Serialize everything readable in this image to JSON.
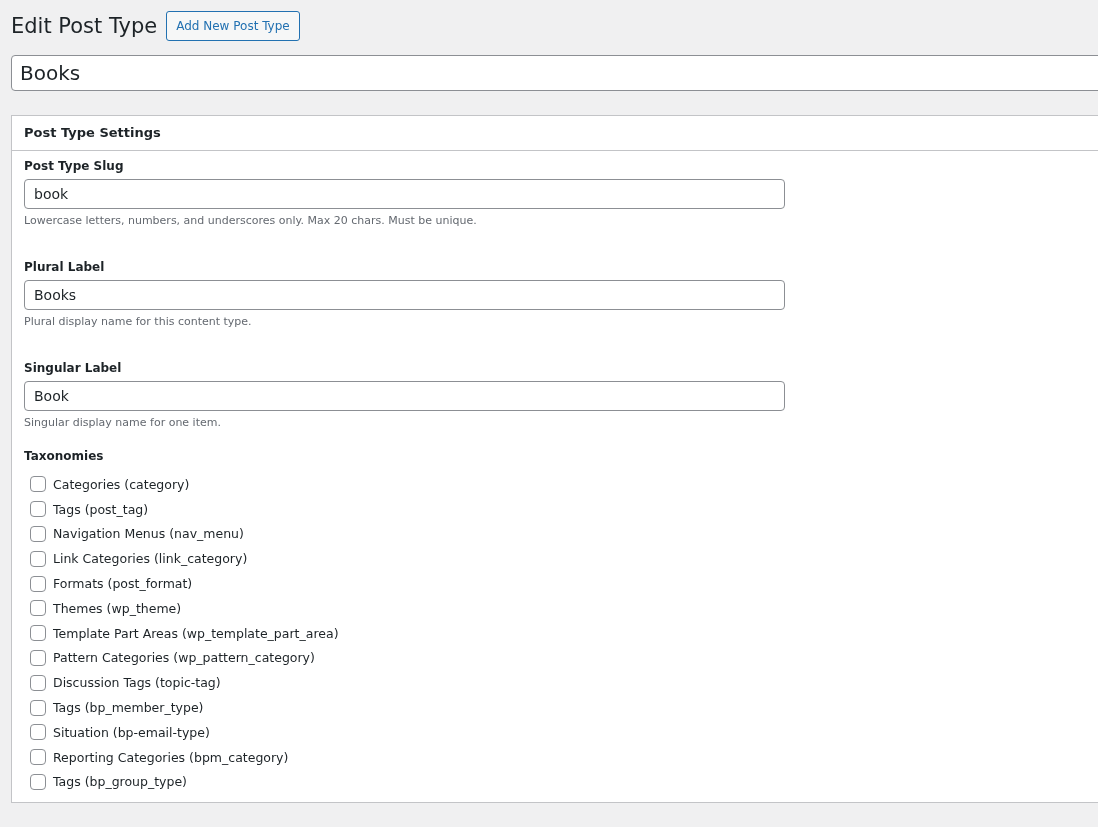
{
  "heading": "Edit Post Type",
  "add_button": "Add New Post Type",
  "title_field": {
    "value": "Books"
  },
  "panel": {
    "title": "Post Type Settings",
    "fields": [
      {
        "label": "Post Type Slug",
        "value": "book",
        "description": "Lowercase letters, numbers, and underscores only. Max 20 chars. Must be unique."
      },
      {
        "label": "Plural Label",
        "value": "Books",
        "description": "Plural display name for this content type."
      },
      {
        "label": "Singular Label",
        "value": "Book",
        "description": "Singular display name for one item."
      }
    ],
    "taxonomies": {
      "label": "Taxonomies",
      "items": [
        {
          "label": "Categories (category)",
          "checked": false
        },
        {
          "label": "Tags (post_tag)",
          "checked": false
        },
        {
          "label": "Navigation Menus (nav_menu)",
          "checked": false
        },
        {
          "label": "Link Categories (link_category)",
          "checked": false
        },
        {
          "label": "Formats (post_format)",
          "checked": false
        },
        {
          "label": "Themes (wp_theme)",
          "checked": false
        },
        {
          "label": "Template Part Areas (wp_template_part_area)",
          "checked": false
        },
        {
          "label": "Pattern Categories (wp_pattern_category)",
          "checked": false
        },
        {
          "label": "Discussion Tags (topic-tag)",
          "checked": false
        },
        {
          "label": "Tags (bp_member_type)",
          "checked": false
        },
        {
          "label": "Situation (bp-email-type)",
          "checked": false
        },
        {
          "label": "Reporting Categories (bpm_category)",
          "checked": false
        },
        {
          "label": "Tags (bp_group_type)",
          "checked": false
        }
      ]
    }
  }
}
